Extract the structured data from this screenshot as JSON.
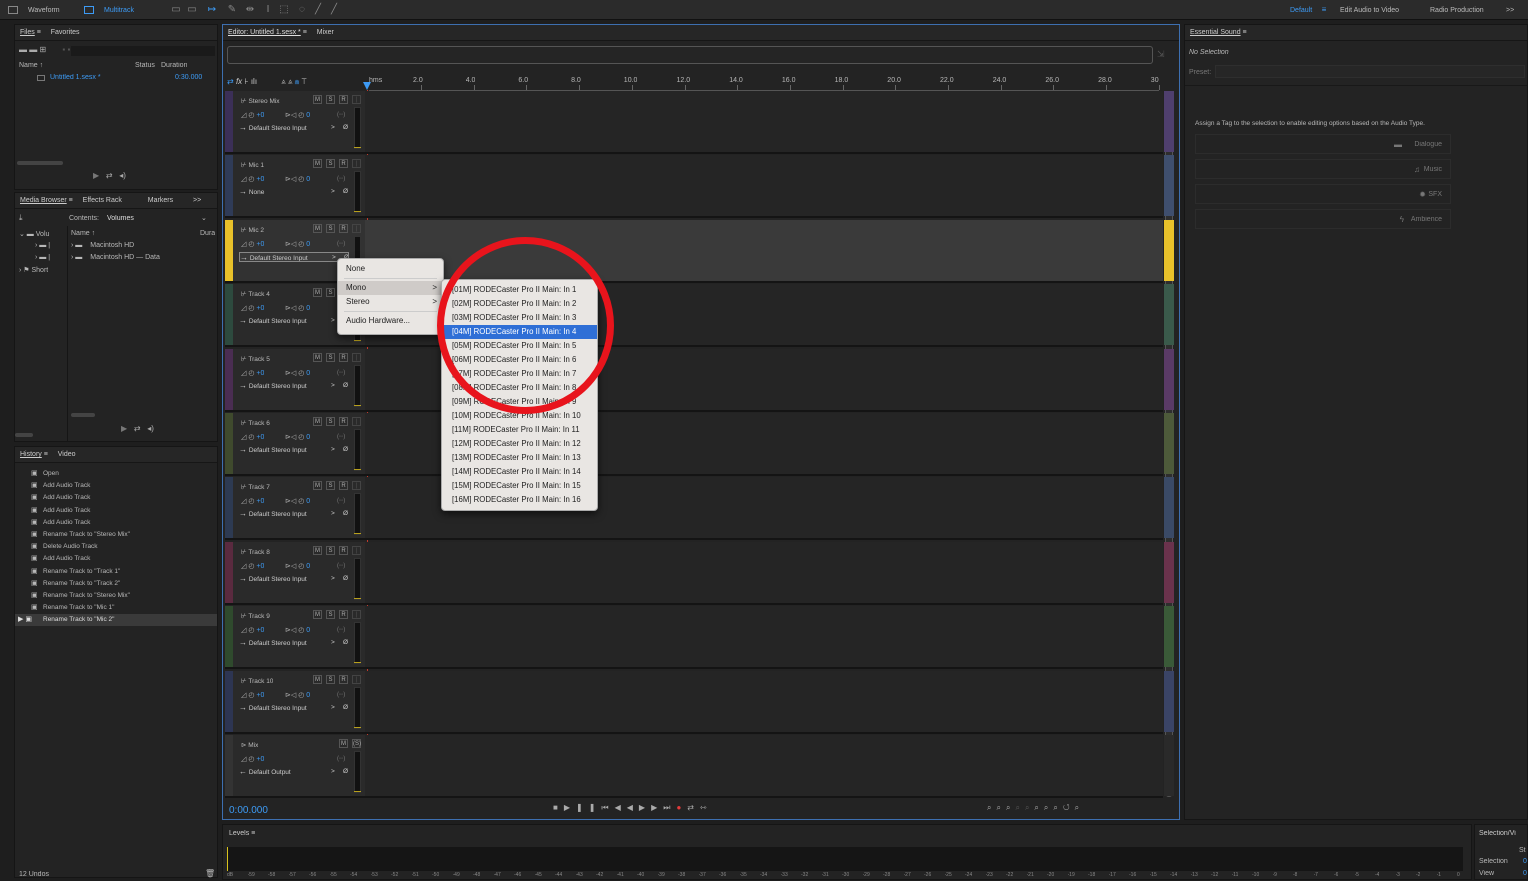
{
  "topbar": {
    "waveform": "Waveform",
    "multitrack": "Multitrack",
    "workspace_default": "Default",
    "edit_audio_video": "Edit Audio to Video",
    "radio_production": "Radio Production",
    "more": ">>"
  },
  "files_panel": {
    "tab_files": "Files",
    "tab_favorites": "Favorites",
    "col_name": "Name ↑",
    "col_status": "Status",
    "col_duration": "Duration",
    "file_name": "Untitled 1.sesx *",
    "file_duration": "0:30.000"
  },
  "media_panel": {
    "tab_media_browser": "Media Browser",
    "tab_effects_rack": "Effects Rack",
    "tab_markers": "Markers",
    "more": ">>",
    "contents_label": "Contents:",
    "contents_value": "Volumes",
    "col_volu": "Volu",
    "col_name": "Name ↑",
    "col_dura": "Dura",
    "item1": "Macintosh HD",
    "item2": "Macintosh HD — Data",
    "item_short": "Short"
  },
  "history_panel": {
    "tab_history": "History",
    "tab_video": "Video",
    "items": [
      "Open",
      "Add Audio Track",
      "Add Audio Track",
      "Add Audio Track",
      "Add Audio Track",
      "Rename Track to \"Stereo Mix\"",
      "Delete Audio Track",
      "Add Audio Track",
      "Rename Track to \"Track 1\"",
      "Rename Track to \"Track 2\"",
      "Rename Track to \"Stereo Mix\"",
      "Rename Track to \"Mic 1\"",
      "Rename Track to \"Mic 2\""
    ],
    "undos": "12 Undos"
  },
  "editor": {
    "tab_editor": "Editor: Untitled 1.sesx *",
    "tab_mixer": "Mixer",
    "ruler_unit": "hms",
    "ruler_ticks": [
      "2.0",
      "4.0",
      "6.0",
      "8.0",
      "10.0",
      "12.0",
      "14.0",
      "16.0",
      "18.0",
      "20.0",
      "22.0",
      "24.0",
      "26.0",
      "28.0",
      "30"
    ],
    "timecode": "0:00.000",
    "btn_m": "M",
    "btn_s": "S",
    "btn_r": "R",
    "vol_value": "+0",
    "pan_value": "0",
    "phase": "Ø",
    "tracks": [
      {
        "name": "Stereo Mix",
        "input": "Default Stereo Input"
      },
      {
        "name": "Mic 1",
        "input": "None"
      },
      {
        "name": "Mic 2",
        "input": "Default Stereo Input"
      },
      {
        "name": "Track 4",
        "input": "Default Stereo Input"
      },
      {
        "name": "Track 5",
        "input": "Default Stereo Input"
      },
      {
        "name": "Track 6",
        "input": "Default Stereo Input"
      },
      {
        "name": "Track 7",
        "input": "Default Stereo Input"
      },
      {
        "name": "Track 8",
        "input": "Default Stereo Input"
      },
      {
        "name": "Track 9",
        "input": "Default Stereo Input"
      },
      {
        "name": "Track 10",
        "input": "Default Stereo Input"
      },
      {
        "name": "Mix",
        "input": "Default Output"
      }
    ]
  },
  "input_menu": {
    "none": "None",
    "mono": "Mono",
    "stereo": "Stereo",
    "audio_hardware": "Audio Hardware..."
  },
  "mono_menu": {
    "items": [
      "[01M] RODECaster Pro II Main: In 1",
      "[02M] RODECaster Pro II Main: In 2",
      "[03M] RODECaster Pro II Main: In 3",
      "[04M] RODECaster Pro II Main: In 4",
      "[05M] RODECaster Pro II Main: In 5",
      "[06M] RODECaster Pro II Main: In 6",
      "[07M] RODECaster Pro II Main: In 7",
      "[08M] RODECaster Pro II Main: In 8",
      "[09M] RODECaster Pro II Main: In 9",
      "[10M] RODECaster Pro II Main: In 10",
      "[11M] RODECaster Pro II Main: In 11",
      "[12M] RODECaster Pro II Main: In 12",
      "[13M] RODECaster Pro II Main: In 13",
      "[14M] RODECaster Pro II Main: In 14",
      "[15M] RODECaster Pro II Main: In 15",
      "[16M] RODECaster Pro II Main: In 16"
    ],
    "highlighted_index": 3
  },
  "essential_sound": {
    "title": "Essential Sound",
    "no_selection": "No Selection",
    "preset": "Preset:",
    "hint": "Assign a Tag to the selection to enable editing options based on the Audio Type.",
    "dialogue": "Dialogue",
    "music": "Music",
    "sfx": "SFX",
    "ambience": "Ambience"
  },
  "levels": {
    "title": "Levels",
    "scale": [
      "dB",
      "-59",
      "-58",
      "-57",
      "-56",
      "-55",
      "-54",
      "-53",
      "-52",
      "-51",
      "-50",
      "-49",
      "-48",
      "-47",
      "-46",
      "-45",
      "-44",
      "-43",
      "-42",
      "-41",
      "-40",
      "-39",
      "-38",
      "-37",
      "-36",
      "-35",
      "-34",
      "-33",
      "-32",
      "-31",
      "-30",
      "-29",
      "-28",
      "-27",
      "-26",
      "-25",
      "-24",
      "-23",
      "-22",
      "-21",
      "-20",
      "-19",
      "-18",
      "-17",
      "-16",
      "-15",
      "-14",
      "-13",
      "-12",
      "-11",
      "-10",
      "-9",
      "-8",
      "-7",
      "-6",
      "-5",
      "-4",
      "-3",
      "-2",
      "-1",
      "0"
    ]
  },
  "selection_panel": {
    "title": "Selection/Vi",
    "st": "St",
    "selection": "Selection",
    "selection_val": "0",
    "view": "View",
    "view_val": "0"
  },
  "colors": {
    "accent": "#3d9bf5",
    "selected_track": "#e8c12a",
    "highlight_ring": "#e8141c",
    "menu_highlight": "#2f6fd6"
  }
}
